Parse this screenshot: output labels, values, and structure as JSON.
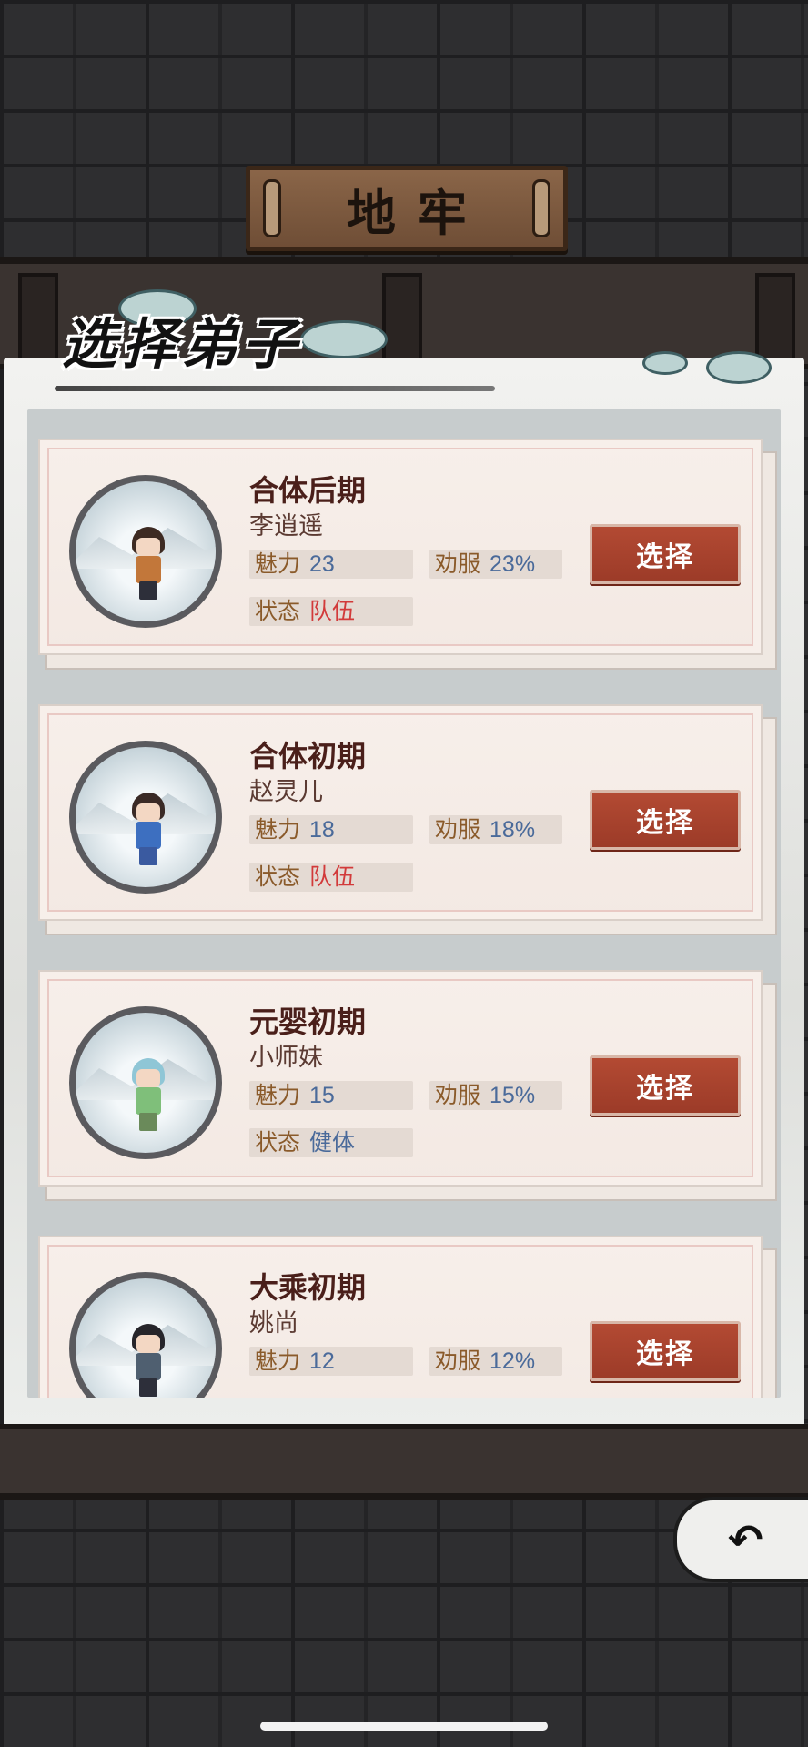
{
  "header": {
    "title": "地牢"
  },
  "panel": {
    "title": "选择弟子"
  },
  "disciples": [
    {
      "realm": "合体后期",
      "name": "李逍遥",
      "charm_label": "魅力",
      "charm": "23",
      "persuade_label": "劝服",
      "persuade": "23%",
      "status_label": "状态",
      "status": "队伍",
      "select_label": "选择",
      "hair": "#3d2a22",
      "outfit": "#c2773a"
    },
    {
      "realm": "合体初期",
      "name": "赵灵儿",
      "charm_label": "魅力",
      "charm": "18",
      "persuade_label": "劝服",
      "persuade": "18%",
      "status_label": "状态",
      "status": "队伍",
      "select_label": "选择",
      "hair": "#3a2a26",
      "outfit": "#3d6fc0"
    },
    {
      "realm": "元婴初期",
      "name": "小师妹",
      "charm_label": "魅力",
      "charm": "15",
      "persuade_label": "劝服",
      "persuade": "15%",
      "status_label": "状态",
      "status": "健体",
      "select_label": "选择",
      "hair": "#8fc6d6",
      "outfit": "#7fbf7a"
    },
    {
      "realm": "大乘初期",
      "name": "姚尚",
      "charm_label": "魅力",
      "charm": "12",
      "persuade_label": "劝服",
      "persuade": "12%",
      "status_label": "",
      "status": "",
      "select_label": "选择",
      "hair": "#26252a",
      "outfit": "#4f5f70"
    }
  ],
  "back_button": {
    "label": "↶"
  },
  "colors": {
    "select_button": "#a8432e",
    "status_team": "#d23a3a",
    "status_normal": "#4a6a9a"
  }
}
